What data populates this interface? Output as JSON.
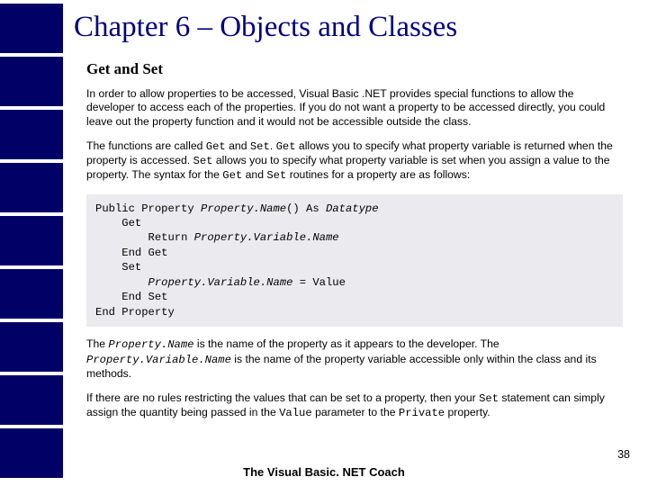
{
  "chapter_title": "Chapter 6 – Objects and Classes",
  "section_title": "Get and Set",
  "p1": "In order to allow properties to be accessed, Visual Basic .NET provides special functions to allow the developer to access each of the properties. If you do not want a property to be accessed directly, you could leave out the property function and it would not be accessible outside the class.",
  "p2a": "The functions are called ",
  "p2_get": "Get",
  "p2b": " and ",
  "p2_set": "Set",
  "p2c": ". ",
  "p2d": " allows you to specify what property variable is returned when the property is accessed. ",
  "p2e": " allows you to specify what property variable is set when you assign a value to the property. The syntax for the ",
  "p2f": " and ",
  "p2g": " routines for a property are as follows:",
  "code": "Public Property Property.Name() As Datatype\n    Get\n        Return Property.Variable.Name\n    End Get\n    Set\n        Property.Variable.Name = Value\n    End Set\nEnd Property",
  "p3a": "The ",
  "p3_pn": "Property.Name",
  "p3b": " is the name of the property as it appears to the developer. The ",
  "p3_pv": "Property.Variable.Name",
  "p3c": " is the name of the property variable accessible only within the class and its methods.",
  "p4a": "If there are no rules restricting the values that can be set to a property, then your ",
  "p4_set": "Set",
  "p4b": " statement can simply assign the quantity being passed in the ",
  "p4_val": "Value",
  "p4c": " parameter to the ",
  "p4_priv": "Private",
  "p4d": " property.",
  "footer": "The Visual Basic. NET Coach",
  "page_num": "38"
}
